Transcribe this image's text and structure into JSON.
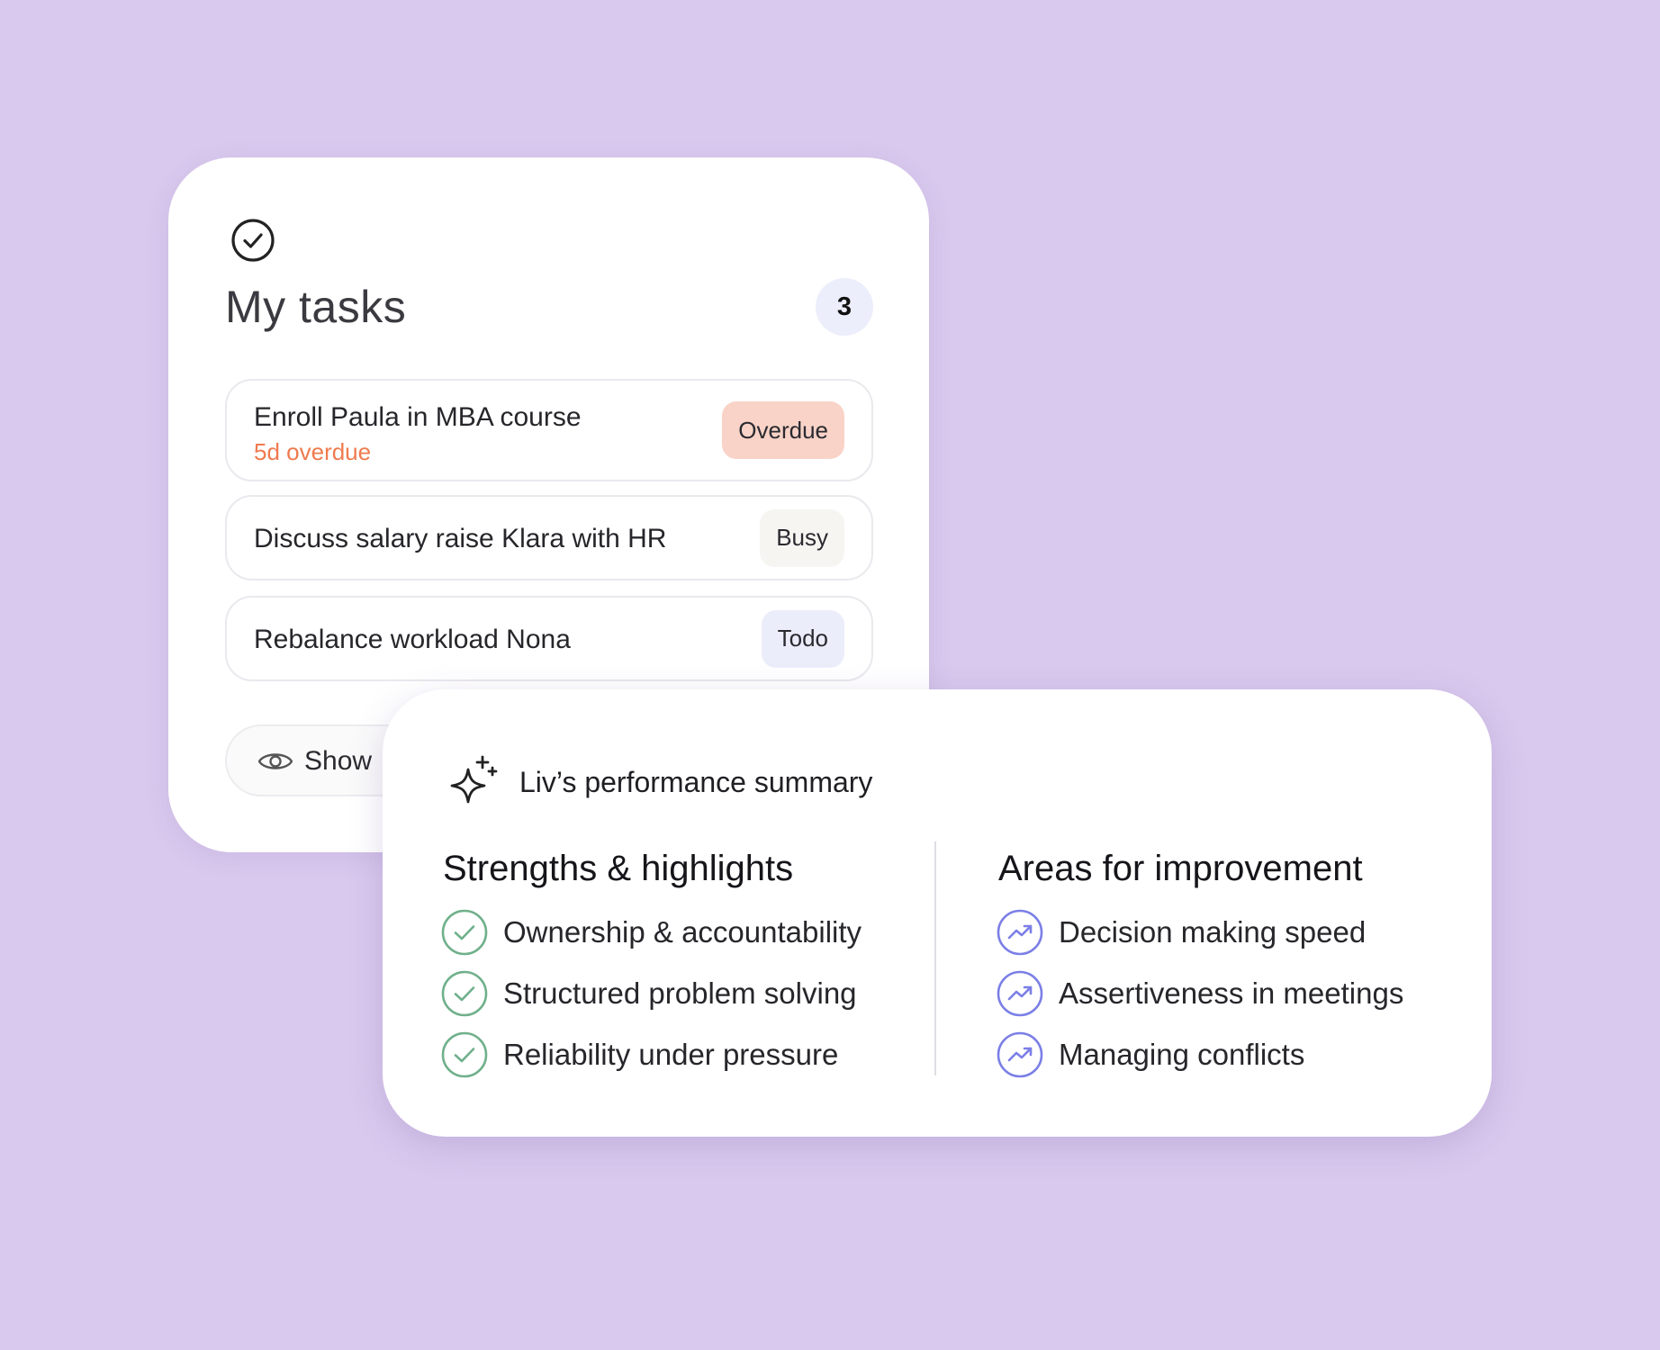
{
  "tasks": {
    "title": "My tasks",
    "count": "3",
    "items": [
      {
        "label": "Enroll Paula in MBA course",
        "sub": "5d overdue",
        "status": "Overdue"
      },
      {
        "label": "Discuss salary raise Klara with HR",
        "status": "Busy"
      },
      {
        "label": "Rebalance workload Nona",
        "status": "Todo"
      }
    ],
    "show_label": "Show"
  },
  "summary": {
    "title": "Liv’s performance summary",
    "strengths": {
      "heading": "Strengths & highlights",
      "items": [
        "Ownership & accountability",
        "Structured problem solving",
        "Reliability under pressure"
      ]
    },
    "improvements": {
      "heading": "Areas for improvement",
      "items": [
        "Decision making speed",
        "Assertiveness in meetings",
        "Managing conflicts"
      ]
    }
  },
  "colors": {
    "background": "#d9c9ee",
    "overdue_text": "#ef7a4e",
    "overdue_badge": "#f9d3c7",
    "todo_badge": "#ebedfb",
    "strength_icon": "#6fb08a",
    "improvement_icon": "#7b7fe6"
  },
  "icons": {
    "tasks": "check-circle-icon",
    "show": "eye-icon",
    "summary": "sparkle-icon",
    "strength": "check-circle-icon",
    "improvement": "trending-up-icon"
  }
}
